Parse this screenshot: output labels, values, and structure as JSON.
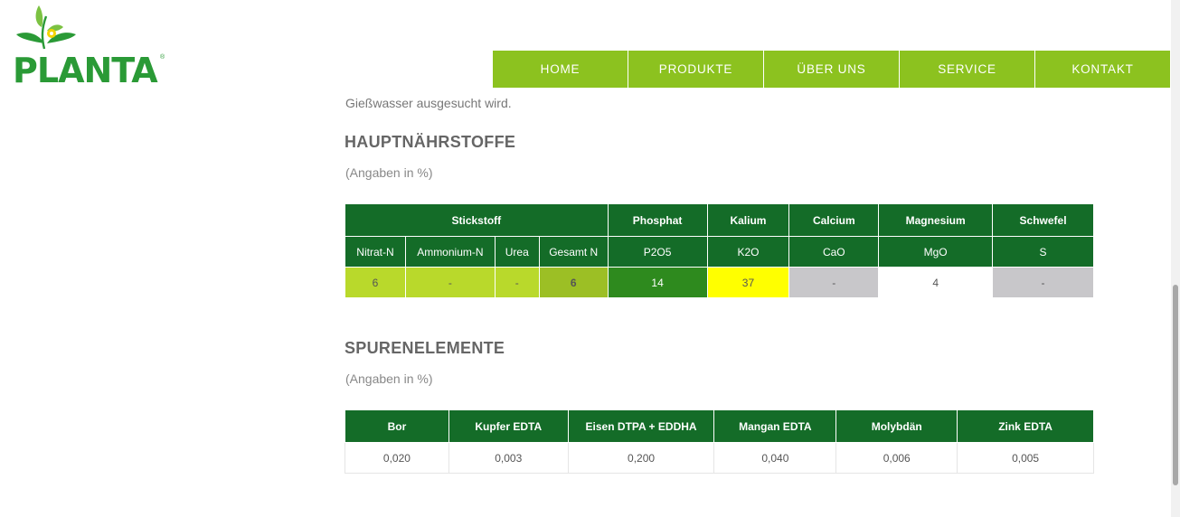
{
  "logo": {
    "text": "PLANTA",
    "reg": "®"
  },
  "nav": [
    "HOME",
    "PRODUKTE",
    "ÜBER UNS",
    "SERVICE",
    "KONTAKT"
  ],
  "intro": "Gießwasser ausgesucht wird.",
  "section1": {
    "title": "HAUPTNÄHRSTOFFE",
    "unit": "(Angaben in %)",
    "groups": [
      "Stickstoff",
      "Phosphat",
      "Kalium",
      "Calcium",
      "Magnesium",
      "Schwefel"
    ],
    "subheaders": [
      "Nitrat-N",
      "Ammonium-N",
      "Urea",
      "Gesamt N",
      "P2O5",
      "K2O",
      "CaO",
      "MgO",
      "S"
    ],
    "values": [
      "6",
      "-",
      "-",
      "6",
      "14",
      "37",
      "-",
      "4",
      "-"
    ],
    "cell_colors": [
      "#b9d92b",
      "#b9d92b",
      "#b9d92b",
      "#9cbf25",
      "#2e8a1e",
      "#ffff00",
      "#c8c7ca",
      "#ffffff",
      "#c8c7ca"
    ]
  },
  "section2": {
    "title": "SPURENELEMENTE",
    "unit": "(Angaben in %)",
    "headers": [
      "Bor",
      "Kupfer EDTA",
      "Eisen DTPA + EDDHA",
      "Mangan EDTA",
      "Molybdän",
      "Zink EDTA"
    ],
    "values": [
      "0,020",
      "0,003",
      "0,200",
      "0,040",
      "0,006",
      "0,005"
    ]
  },
  "colors": {
    "nav": "#8cc21f",
    "header": "#146c28",
    "brand": "#2a9a36"
  }
}
